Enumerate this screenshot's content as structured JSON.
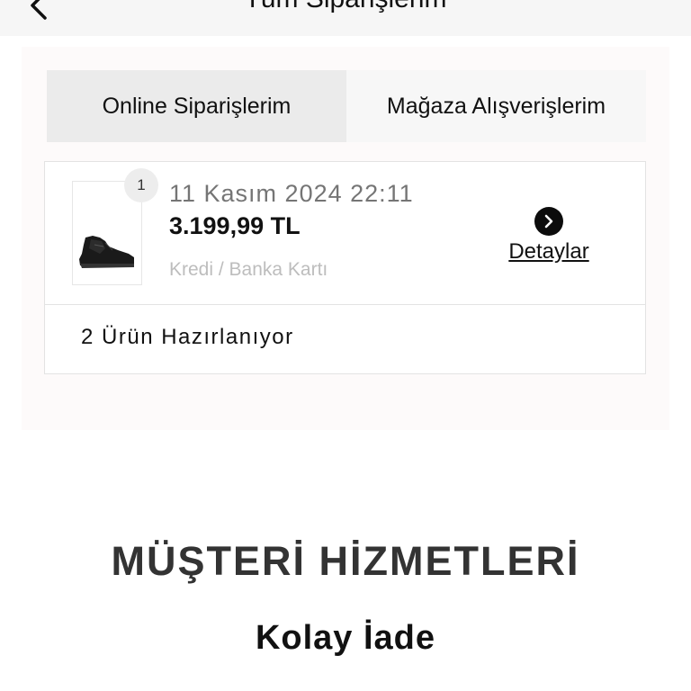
{
  "header": {
    "title": "Tüm Siparişlerim",
    "back_icon": "chevron-left-icon"
  },
  "tabs": [
    {
      "label": "Online Siparişlerim",
      "active": true
    },
    {
      "label": "Mağaza Alışverişlerim",
      "active": false
    }
  ],
  "order": {
    "quantity_badge": "1",
    "date": "11 Kasım 2024 22:11",
    "total": "3.199,99 TL",
    "payment_method": "Kredi / Banka Kartı",
    "detail_label": "Detaylar",
    "detail_icon": "chevron-right-icon",
    "product_image": "black-hiking-boot-thumbnail",
    "status": "2 Ürün Hazırlanıyor"
  },
  "customer_service": {
    "title": "MÜŞTERİ HİZMETLERİ",
    "link": "Kolay İade"
  },
  "colors": {
    "accent": "#0c0c0c",
    "tab_active_bg": "#ebebeb",
    "muted_text": "#757575"
  }
}
